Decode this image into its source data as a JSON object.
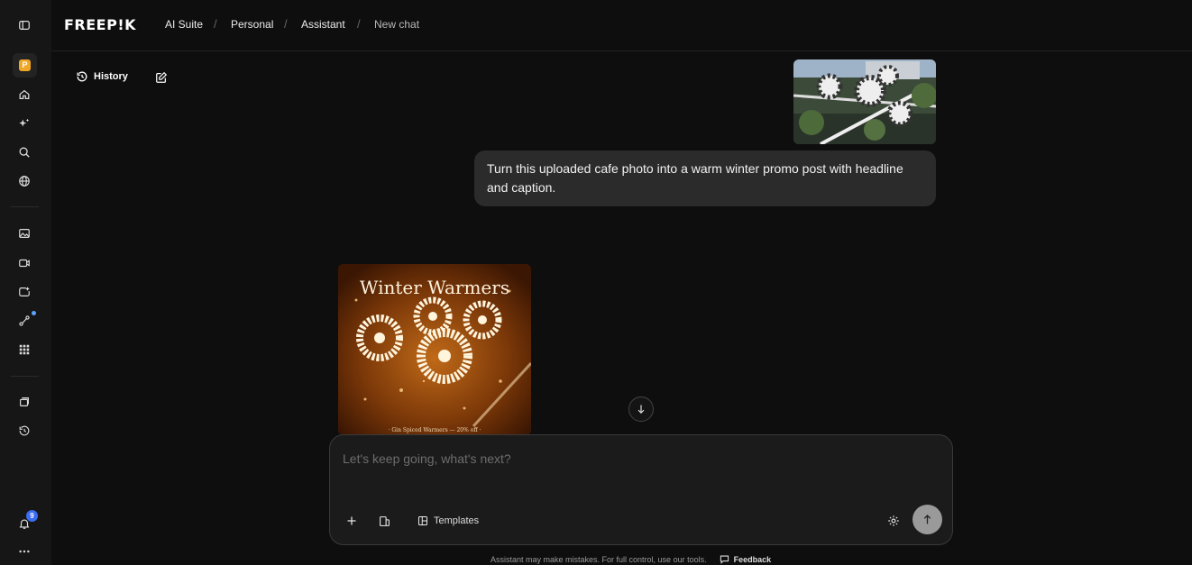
{
  "brand": {
    "logo_text": "FREEP!K"
  },
  "breadcrumb": [
    "AI Suite",
    "Personal",
    "Assistant",
    "New chat"
  ],
  "workspace_badge": "P",
  "notifications": {
    "count": "9"
  },
  "chat": {
    "history_label": "History",
    "user_message": "Turn this uploaded cafe photo into a warm winter promo post with headline and caption.",
    "generated_image": {
      "headline": "Winter Warmers",
      "caption": "· Gin Spiced Warmers — 20% off ·"
    }
  },
  "composer": {
    "placeholder": "Let's keep going, what's next?",
    "templates_label": "Templates"
  },
  "footer": {
    "disclaimer": "Assistant may make mistakes. For full control, use our tools.",
    "feedback_label": "Feedback"
  },
  "colors": {
    "accent": "#f0a727",
    "notification": "#3b6cf2",
    "bubble": "#2b2b2b"
  }
}
